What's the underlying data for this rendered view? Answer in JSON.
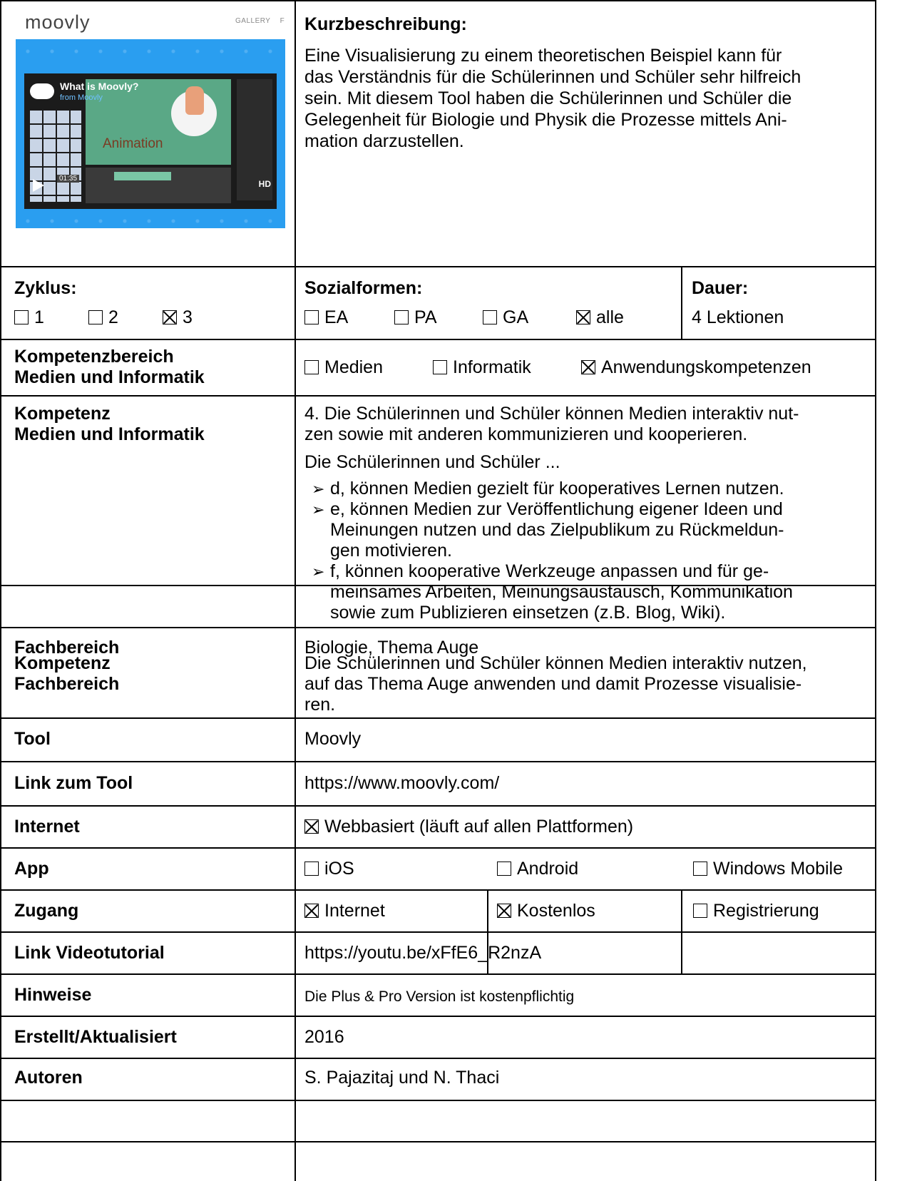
{
  "preview": {
    "logo_text": "moovly",
    "gallery_text": "GALLERY",
    "gallery_extra": "F",
    "video_title": "What is Moovly?",
    "video_subtitle": "from Moovly",
    "stage_word": "Animation",
    "time": "01:35",
    "hd": "HD"
  },
  "description": {
    "heading": "Kurzbeschreibung:",
    "lines": [
      "Eine Visualisierung zu einem theoretischen Beispiel kann für",
      "das Verständnis für die Schülerinnen und Schüler sehr hilfreich",
      "sein. Mit diesem Tool haben die Schülerinnen und Schüler die",
      "Gelegenheit für Biologie und Physik die Prozesse mittels Ani-",
      "mation darzustellen."
    ]
  },
  "zyklus": {
    "label": "Zyklus:",
    "options": [
      {
        "label": "1",
        "checked": false
      },
      {
        "label": "2",
        "checked": false
      },
      {
        "label": "3",
        "checked": true
      }
    ]
  },
  "sozialformen": {
    "label": "Sozialformen:",
    "options": [
      {
        "label": "EA",
        "checked": false
      },
      {
        "label": "PA",
        "checked": false
      },
      {
        "label": "GA",
        "checked": false
      },
      {
        "label": "alle",
        "checked": true
      }
    ]
  },
  "dauer": {
    "label": "Dauer:",
    "value": "4 Lektionen"
  },
  "kompetenzbereich": {
    "label_line1": "Kompetenzbereich",
    "label_line2": "Medien und Informatik",
    "options": [
      {
        "label": "Medien",
        "checked": false
      },
      {
        "label": "Informatik",
        "checked": false
      },
      {
        "label": "Anwendungskompetenzen",
        "checked": true
      }
    ]
  },
  "kompetenz_mi": {
    "label_line1": "Kompetenz",
    "label_line2": "Medien und Informatik",
    "intro_lines": [
      "4. Die Schülerinnen und Schüler können Medien interaktiv nut-",
      "zen sowie mit anderen kommunizieren und kooperieren."
    ],
    "lead": "Die Schülerinnen und Schüler ...",
    "bullets": [
      [
        "d, können Medien gezielt für kooperatives Lernen nutzen."
      ],
      [
        "e, können Medien zur Veröffentlichung eigener Ideen und",
        "Meinungen nutzen und das Zielpublikum zu Rückmeldun-",
        "gen motivieren."
      ],
      [
        "f, können kooperative Werkzeuge anpassen und für ge-",
        "meinsames Arbeiten, Meinungsaustausch, Kommunikation",
        "sowie zum Publizieren einsetzen (z.B. Blog, Wiki)."
      ]
    ]
  },
  "fachbereich": {
    "label": "Fachbereich",
    "value": "Biologie, Thema Auge"
  },
  "kompetenz_fb": {
    "label_line1": "Kompetenz",
    "label_line2": "Fachbereich",
    "lines": [
      "Die Schülerinnen und Schüler können Medien interaktiv nutzen,",
      "auf das Thema Auge anwenden und damit Prozesse visualisie-",
      "ren."
    ]
  },
  "tool": {
    "label": "Tool",
    "value": "Moovly"
  },
  "link_tool": {
    "label": "Link zum Tool",
    "value": "https://www.moovly.com/"
  },
  "internet": {
    "label": "Internet",
    "option": {
      "label": "Webbasiert (läuft auf allen Plattformen)",
      "checked": true
    }
  },
  "app": {
    "label": "App",
    "options": [
      {
        "label": "iOS",
        "checked": false
      },
      {
        "label": "Android",
        "checked": false
      },
      {
        "label": "Windows Mobile",
        "checked": false
      }
    ]
  },
  "zugang": {
    "label": "Zugang",
    "options": [
      {
        "label": "Internet",
        "checked": true
      },
      {
        "label": "Kostenlos",
        "checked": true
      },
      {
        "label": "Registrierung",
        "checked": false
      }
    ]
  },
  "link_video": {
    "label": "Link Videotutorial",
    "value": "https://youtu.be/xFfE6_R2nzA"
  },
  "hinweise": {
    "label": "Hinweise",
    "value": "Die Plus & Pro Version ist kostenpflichtig"
  },
  "erstellt": {
    "label": "Erstellt/Aktualisiert",
    "value": "2016"
  },
  "autoren": {
    "label": "Autoren",
    "value": "S. Pajazitaj und N. Thaci"
  }
}
